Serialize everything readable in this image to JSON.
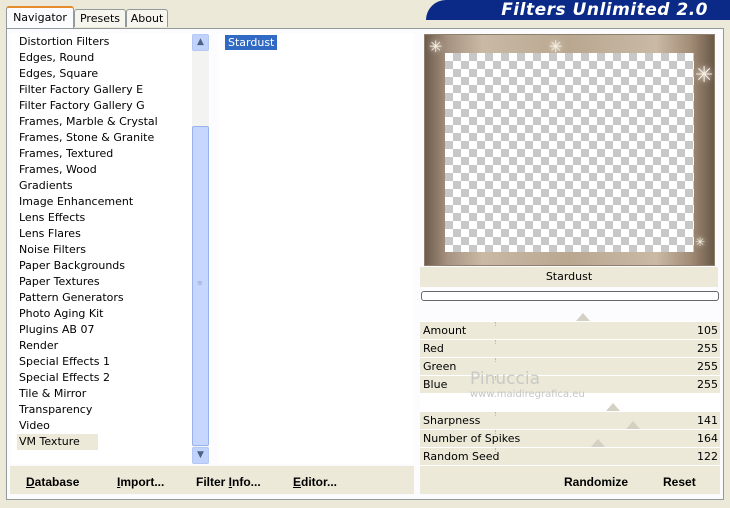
{
  "window": {
    "title": "Filters Unlimited 2.0"
  },
  "tabs": [
    {
      "label": "Navigator",
      "active": true
    },
    {
      "label": "Presets",
      "active": false
    },
    {
      "label": "About",
      "active": false
    }
  ],
  "categories": [
    "Distortion Filters",
    "Edges, Round",
    "Edges, Square",
    "Filter Factory Gallery E",
    "Filter Factory Gallery G",
    "Frames, Marble & Crystal",
    "Frames, Stone & Granite",
    "Frames, Textured",
    "Frames, Wood",
    "Gradients",
    "Image Enhancement",
    "Lens Effects",
    "Lens Flares",
    "Noise Filters",
    "Paper Backgrounds",
    "Paper Textures",
    "Pattern Generators",
    "Photo Aging Kit",
    "Plugins AB 07",
    "Render",
    "Special Effects 1",
    "Special Effects 2",
    "Tile & Mirror",
    "Transparency",
    "Video",
    "VM Texture"
  ],
  "selected_category": "VM Texture",
  "filters": [
    "Stardust"
  ],
  "preview": {
    "filter_name": "Stardust"
  },
  "parameters": [
    {
      "label": "Amount",
      "value": "105",
      "level": 0.41
    },
    {
      "label": "Red",
      "value": "255",
      "level": 1.0
    },
    {
      "label": "Green",
      "value": "255",
      "level": 1.0
    },
    {
      "label": "Blue",
      "value": "255",
      "level": 1.0
    },
    {
      "label": "",
      "value": "",
      "level": null
    },
    {
      "label": "Sharpness",
      "value": "141",
      "level": 0.55
    },
    {
      "label": "Number of Spikes",
      "value": "164",
      "level": 0.64
    },
    {
      "label": "Random Seed",
      "value": "122",
      "level": 0.48
    }
  ],
  "watermark": {
    "line1": "Pinuccia",
    "line2": "www.maidiregrafica.eu"
  },
  "buttons": {
    "database": {
      "pre": "",
      "ul": "D",
      "post": "atabase"
    },
    "import": {
      "pre": "",
      "ul": "I",
      "post": "mport..."
    },
    "filter_info": {
      "pre": "Filter ",
      "ul": "I",
      "post": "nfo..."
    },
    "editor": {
      "pre": "",
      "ul": "E",
      "post": "ditor..."
    },
    "randomize": "Randomize",
    "reset": "Reset"
  },
  "icons": {
    "scroll_up": "arrow-up-icon",
    "scroll_down": "arrow-down-icon"
  }
}
